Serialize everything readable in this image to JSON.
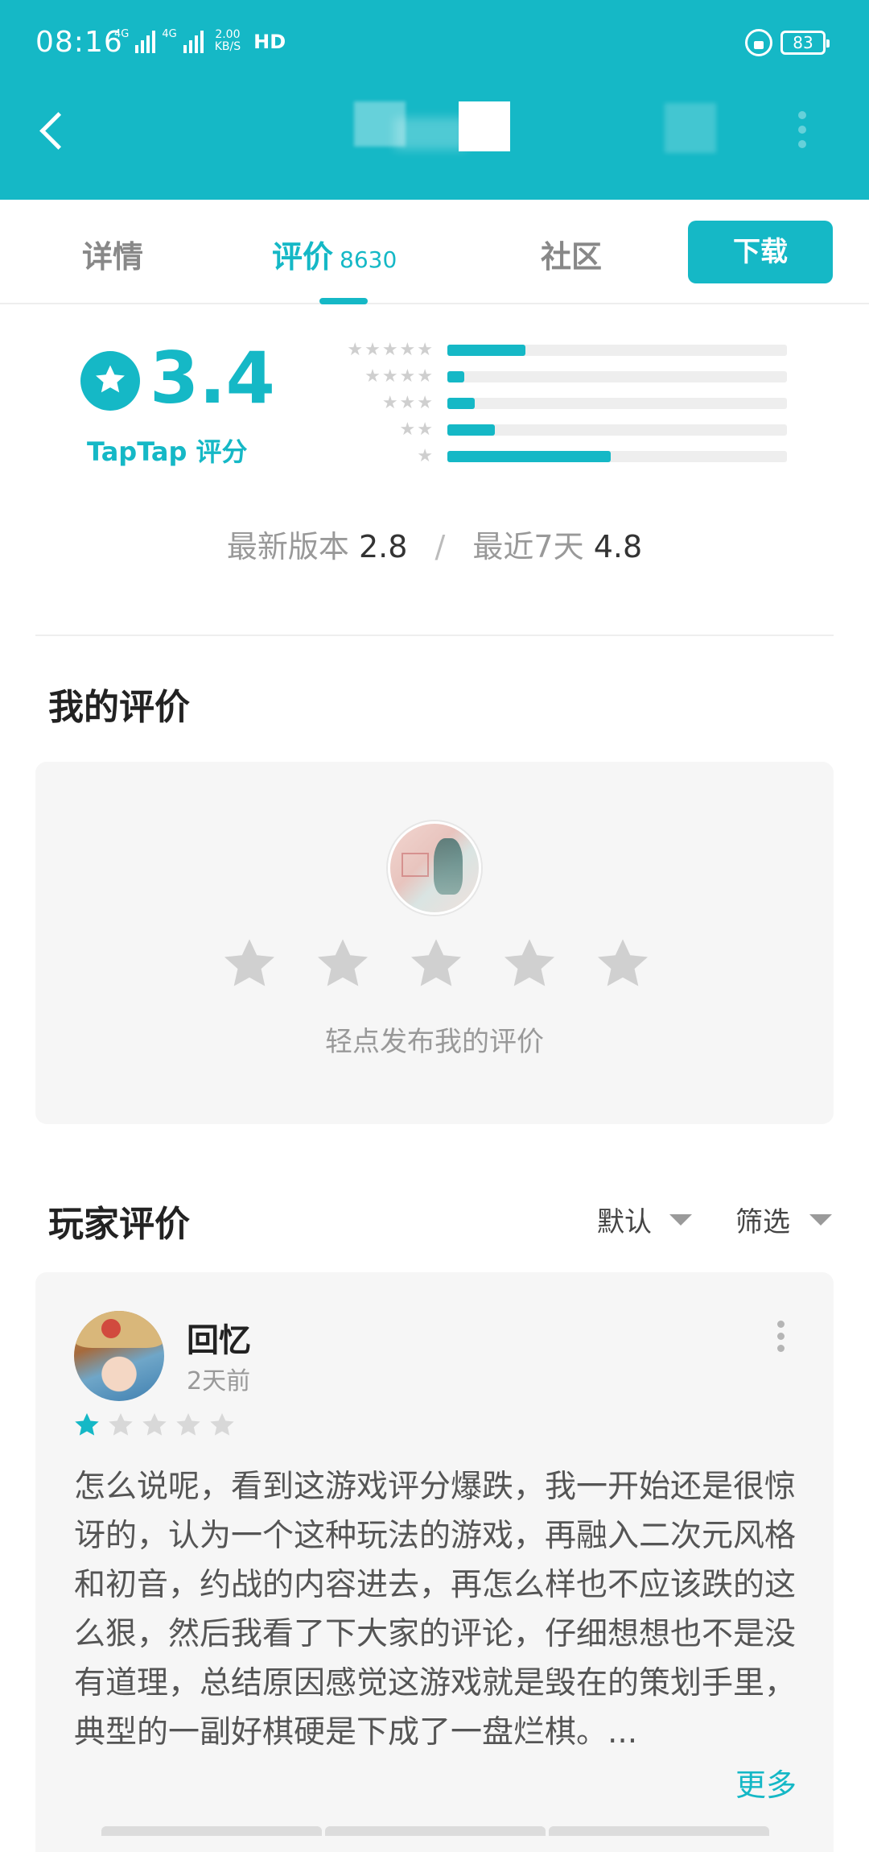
{
  "status_bar": {
    "time": "08:16",
    "net1": "4G",
    "net2": "4G",
    "speed_value": "2.00",
    "speed_unit": "KB/S",
    "hd": "HD",
    "battery": "83"
  },
  "tabs": {
    "details": "详情",
    "reviews": "评价",
    "reviews_count": "8630",
    "community": "社区",
    "download": "下载"
  },
  "rating": {
    "score": "3.4",
    "label": "TapTap 评分",
    "distribution": [
      {
        "stars": 5,
        "fraction": 0.23
      },
      {
        "stars": 4,
        "fraction": 0.05
      },
      {
        "stars": 3,
        "fraction": 0.08
      },
      {
        "stars": 2,
        "fraction": 0.14
      },
      {
        "stars": 1,
        "fraction": 0.48
      }
    ],
    "version_label": "最新版本",
    "version_score": "2.8",
    "separator": "/",
    "recent_label": "最近7天",
    "recent_score": "4.8"
  },
  "my_review": {
    "title": "我的评价",
    "hint": "轻点发布我的评价"
  },
  "player_reviews": {
    "title": "玩家评价",
    "sort_default": "默认",
    "sort_filter": "筛选",
    "items": [
      {
        "user": "回忆",
        "time": "2天前",
        "stars": 1,
        "text": "怎么说呢，看到这游戏评分爆跌，我一开始还是很惊讶的，认为一个这种玩法的游戏，再融入二次元风格和初音，约战的内容进去，再怎么样也不应该跌的这么狠，然后我看了下大家的评论，仔细想想也不是没有道理，总结原因感觉这游戏就是毁在的策划手里，典型的一副好棋硬是下成了一盘烂棋。...",
        "more": "更多"
      }
    ]
  },
  "colors": {
    "accent": "#15b8c6",
    "star_inactive": "#d0d0d0"
  }
}
